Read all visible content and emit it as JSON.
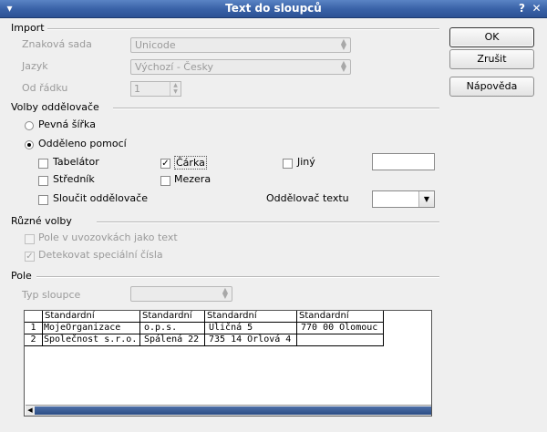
{
  "window": {
    "title": "Text do sloupců"
  },
  "buttons": {
    "ok": "OK",
    "cancel": "Zrušit",
    "help": "Nápověda"
  },
  "import": {
    "title": "Import",
    "charset_label": "Znaková sada",
    "charset_value": "Unicode",
    "language_label": "Jazyk",
    "language_value": "Výchozí - Česky",
    "from_row_label": "Od řádku",
    "from_row_value": "1"
  },
  "separator_options": {
    "title": "Volby oddělovače",
    "fixed_width": "Pevná šířka",
    "separated_by": "Odděleno pomocí",
    "tab": "Tabelátor",
    "comma": "Čárka",
    "other": "Jiný",
    "semicolon": "Středník",
    "space": "Mezera",
    "merge": "Sloučit oddělovače",
    "text_delimiter_label": "Oddělovač textu",
    "text_delimiter_value": "",
    "other_value": ""
  },
  "other_options": {
    "title": "Různé volby",
    "quoted_as_text": "Pole v uvozovkách jako text",
    "detect_special": "Detekovat speciální čísla"
  },
  "fields": {
    "title": "Pole",
    "column_type_label": "Typ sloupce",
    "column_type_value": "",
    "headers": [
      "Standardní",
      "Standardní",
      "Standardní",
      "Standardní"
    ],
    "rows": [
      {
        "num": "1",
        "cells": [
          "MojeOrganizace",
          "o.p.s.",
          "Uličná 5",
          "770 00 Olomouc"
        ]
      },
      {
        "num": "2",
        "cells": [
          "Společnost s.r.o.",
          "Spálená 22",
          "735 14 Orlová 4",
          ""
        ]
      }
    ]
  }
}
